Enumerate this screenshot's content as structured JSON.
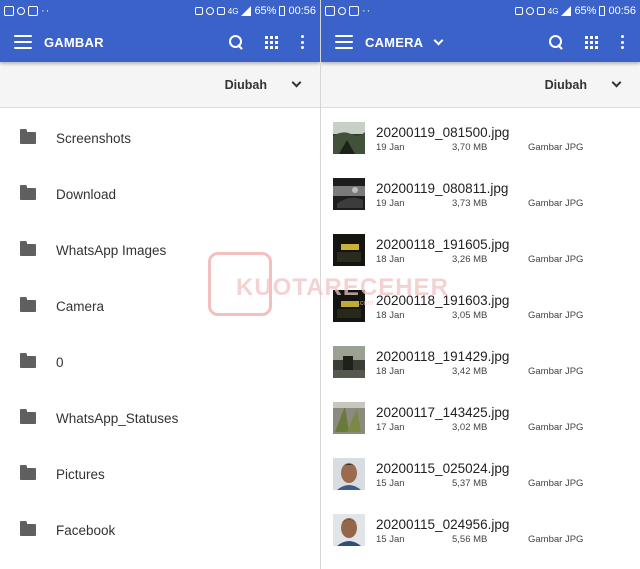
{
  "status_bar": {
    "battery": "65%",
    "time": "00:56",
    "network": "4G",
    "dots": "··"
  },
  "left": {
    "title": "GAMBAR",
    "sort_label": "Diubah",
    "folders": [
      "Screenshots",
      "Download",
      "WhatsApp Images",
      "Camera",
      "0",
      "WhatsApp_Statuses",
      "Pictures",
      "Facebook"
    ]
  },
  "right": {
    "title": "CAMERA",
    "sort_label": "Diubah",
    "files": [
      {
        "name": "20200119_081500.jpg",
        "date": "19 Jan",
        "size": "3,70 MB",
        "type": "Gambar JPG"
      },
      {
        "name": "20200119_080811.jpg",
        "date": "19 Jan",
        "size": "3,73 MB",
        "type": "Gambar JPG"
      },
      {
        "name": "20200118_191605.jpg",
        "date": "18 Jan",
        "size": "3,26 MB",
        "type": "Gambar JPG"
      },
      {
        "name": "20200118_191603.jpg",
        "date": "18 Jan",
        "size": "3,05 MB",
        "type": "Gambar JPG"
      },
      {
        "name": "20200118_191429.jpg",
        "date": "18 Jan",
        "size": "3,42 MB",
        "type": "Gambar JPG"
      },
      {
        "name": "20200117_143425.jpg",
        "date": "17 Jan",
        "size": "3,02 MB",
        "type": "Gambar JPG"
      },
      {
        "name": "20200115_025024.jpg",
        "date": "15 Jan",
        "size": "5,37 MB",
        "type": "Gambar JPG"
      },
      {
        "name": "20200115_024956.jpg",
        "date": "15 Jan",
        "size": "5,56 MB",
        "type": "Gambar JPG"
      }
    ]
  },
  "watermark": {
    "text": "KUOTARECEHER",
    "sub": ".com"
  },
  "colors": {
    "toolbar": "#3a62c9",
    "sortbar": "#f5f5f5",
    "folder_icon": "#5f5f5f"
  },
  "icons": {
    "menu": "hamburger-icon",
    "search": "search-icon",
    "view": "grid-view-icon",
    "more": "more-vert-icon",
    "folder": "folder-icon",
    "dropdown": "chevron-down-icon"
  }
}
